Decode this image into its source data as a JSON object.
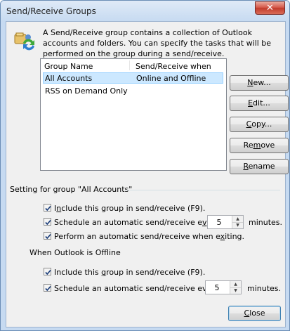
{
  "window": {
    "title": "Send/Receive Groups",
    "close_glyph": "✕"
  },
  "description": "A Send/Receive group contains a collection of Outlook accounts and folders. You can specify the tasks that will be performed on the group during a send/receive.",
  "groups_table": {
    "columns": [
      "Group Name",
      "Send/Receive when"
    ],
    "rows": [
      {
        "name": "All Accounts",
        "when": "Online and Offline",
        "selected": true
      },
      {
        "name": "RSS on Demand Only",
        "when": "",
        "selected": false
      }
    ]
  },
  "buttons": {
    "new": {
      "pre": "",
      "key": "N",
      "post": "ew..."
    },
    "edit": {
      "pre": "",
      "key": "E",
      "post": "dit..."
    },
    "copy": {
      "pre": "",
      "key": "C",
      "post": "opy..."
    },
    "remove": {
      "pre": "Re",
      "key": "m",
      "post": "ove"
    },
    "rename": {
      "pre": "",
      "key": "R",
      "post": "ename"
    },
    "close": {
      "pre": "",
      "key": "C",
      "post": "lose"
    }
  },
  "online_section": {
    "title": "Setting for group \"All Accounts\"",
    "include": {
      "pre": "I",
      "key": "n",
      "post": "clude this group in send/receive (F9).",
      "checked": true
    },
    "schedule": {
      "pre": "Schedule an automatic send/receive e",
      "key": "v",
      "post": "ery",
      "checked": true
    },
    "interval": "5",
    "minutes": "minutes.",
    "exit": {
      "pre": "Perform an automatic send/receive when e",
      "key": "x",
      "post": "iting.",
      "checked": true
    }
  },
  "offline_section": {
    "title": "When Outlook is Offline",
    "include": {
      "pre": "Include this ",
      "key": "g",
      "post": "roup in send/receive (F9).",
      "checked": true
    },
    "schedule": {
      "pre": "Schedule an automatic send/receive ever",
      "key": "y",
      "post": "",
      "checked": true
    },
    "interval": "5",
    "minutes": "minutes."
  },
  "icons": {
    "groups": "send-receive-groups-icon",
    "check": "checkmark-icon",
    "spin_up": "spin-up-arrow-icon",
    "spin_down": "spin-down-arrow-icon"
  }
}
